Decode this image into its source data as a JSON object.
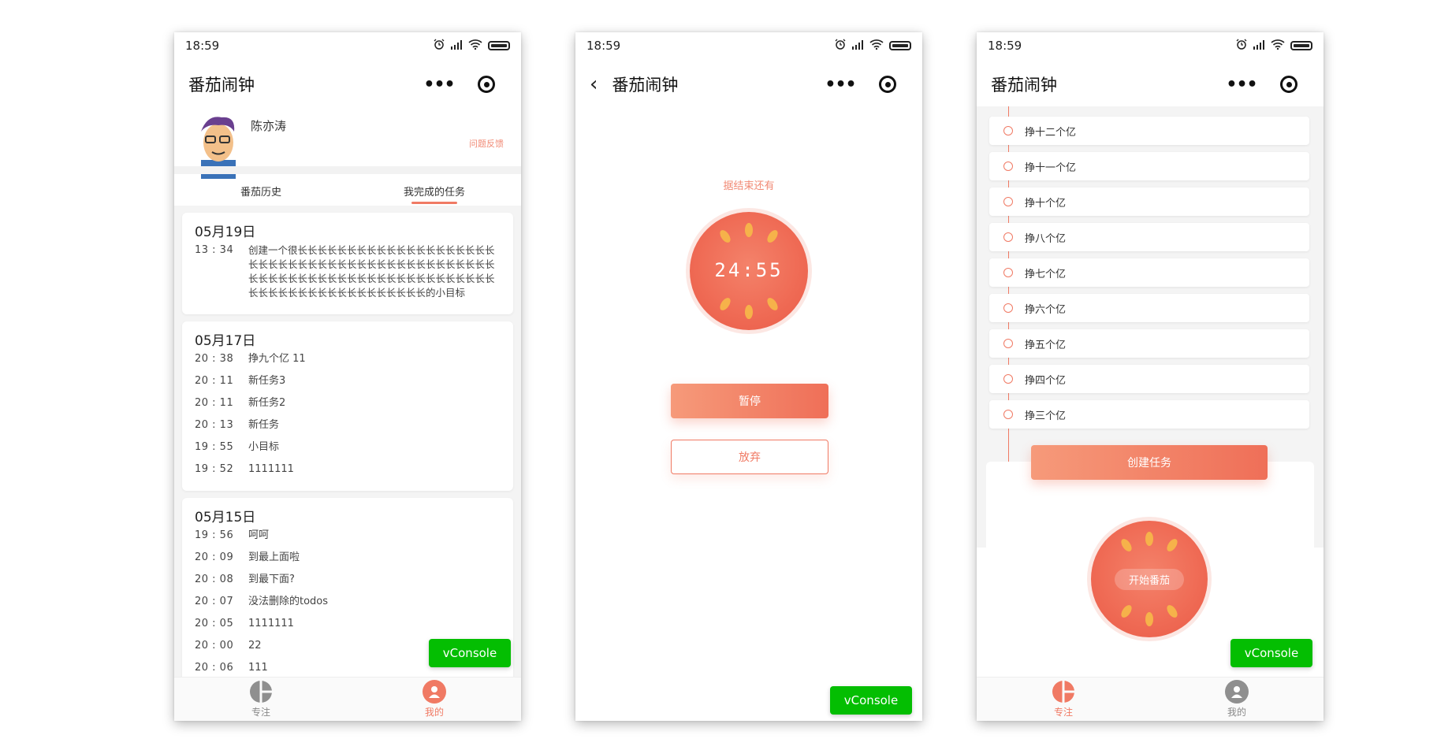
{
  "status": {
    "time": "18:59"
  },
  "app_title": "番茄闹钟",
  "profile": {
    "name": "陈亦涛",
    "feedback": "问题反馈"
  },
  "tabs": [
    "番茄历史",
    "我完成的任务"
  ],
  "history": [
    {
      "date": "05月19日",
      "entries": [
        {
          "time": "13 : 34",
          "text": "创建一个很长长长长长长长长长长长长长长长长长长长长长长长长长长长长长长长长长长长长长长长长长长长长长长长长长长长长长长长长长长长长长长长长长长长长长长长长长长长长长长长长长长长长长长长长的小目标"
        }
      ]
    },
    {
      "date": "05月17日",
      "entries": [
        {
          "time": "20 : 38",
          "text": "挣九个亿 11"
        },
        {
          "time": "20 : 11",
          "text": "新任务3"
        },
        {
          "time": "20 : 11",
          "text": "新任务2"
        },
        {
          "time": "20 : 13",
          "text": "新任务"
        },
        {
          "time": "19 : 55",
          "text": "小目标"
        },
        {
          "time": "19 : 52",
          "text": "1111111"
        }
      ]
    },
    {
      "date": "05月15日",
      "entries": [
        {
          "time": "19 : 56",
          "text": "呵呵"
        },
        {
          "time": "20 : 09",
          "text": "到最上面啦"
        },
        {
          "time": "20 : 08",
          "text": "到最下面?"
        },
        {
          "time": "20 : 07",
          "text": "没法删除的todos"
        },
        {
          "time": "20 : 05",
          "text": "1111111"
        },
        {
          "time": "20 : 00",
          "text": "22"
        },
        {
          "time": "20 : 06",
          "text": "111"
        }
      ]
    }
  ],
  "tabbar": {
    "focus": "专注",
    "mine": "我的"
  },
  "vconsole": "vConsole",
  "timer": {
    "label": "据结束还有",
    "time": "24:55",
    "pause": "暂停",
    "give_up": "放弃"
  },
  "tasks": [
    "挣十二个亿",
    "挣十一个亿",
    "挣十个亿",
    "挣八个亿",
    "挣七个亿",
    "挣六个亿",
    "挣五个亿",
    "挣四个亿",
    "挣三个亿"
  ],
  "create_task": "创建任务",
  "start_pomodoro": "开始番茄",
  "colors": {
    "accent": "#f07a64",
    "vconsole": "#04be02"
  }
}
